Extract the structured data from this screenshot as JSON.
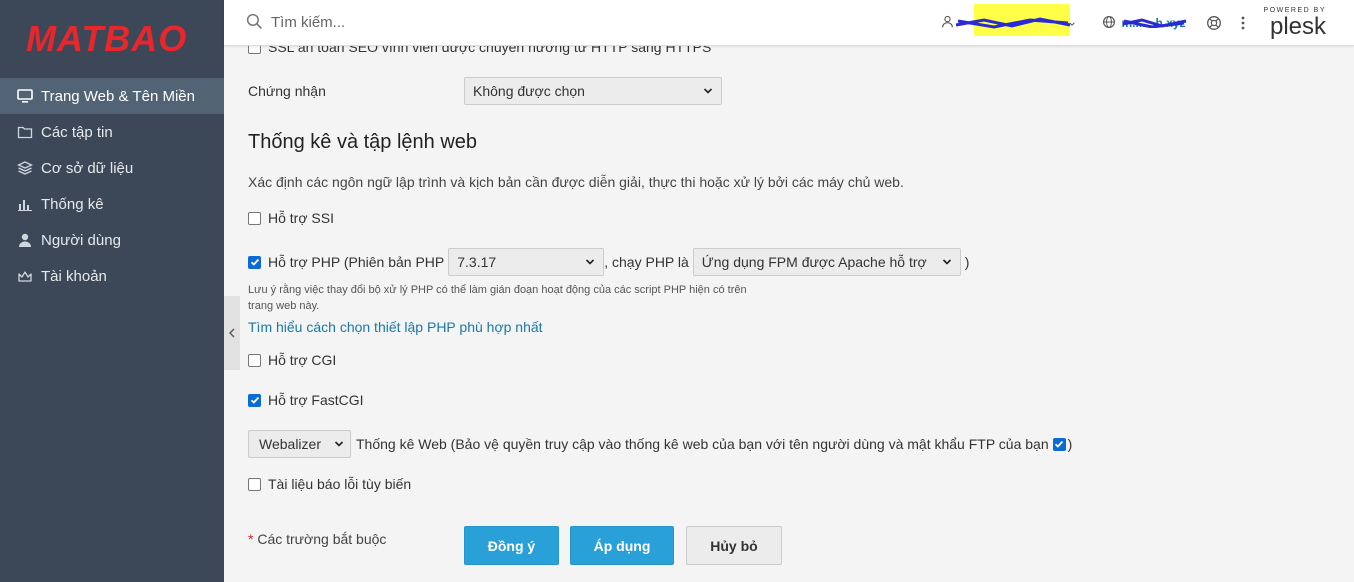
{
  "brand": {
    "logo": "MATBAO"
  },
  "search": {
    "placeholder": "Tìm kiếm..."
  },
  "header": {
    "domain": "m.......h.xyz",
    "powered_by": "POWERED BY",
    "plesk": "plesk"
  },
  "sidebar": {
    "items": [
      {
        "label": "Trang Web & Tên Miền",
        "icon": "monitor-icon",
        "active": true
      },
      {
        "label": "Các tập tin",
        "icon": "folder-icon"
      },
      {
        "label": "Cơ sở dữ liệu",
        "icon": "database-icon"
      },
      {
        "label": "Thống kê",
        "icon": "bar-chart-icon"
      },
      {
        "label": "Người dùng",
        "icon": "user-icon"
      },
      {
        "label": "Tài khoản",
        "icon": "crown-icon"
      }
    ]
  },
  "form": {
    "cut_top_label": "SSL an toàn SEO vĩnh viễn được chuyển hướng từ HTTP sang HTTPS",
    "certificate_label": "Chứng nhận",
    "certificate_value": "Không được chọn",
    "section_title": "Thống kê và tập lệnh web",
    "section_desc": "Xác định các ngôn ngữ lập trình và kịch bản cần được diễn giải, thực thi hoặc xử lý bởi các máy chủ web.",
    "ssi_label": "Hỗ trợ SSI",
    "php_label_pre": "Hỗ trợ PHP (Phiên bản PHP",
    "php_version": "7.3.17",
    "php_run_as_label": ", chạy PHP là",
    "php_handler": "Ứng dụng FPM được Apache hỗ trợ",
    "php_label_post": ")",
    "php_note": "Lưu ý rằng việc thay đổi bộ xử lý PHP có thể làm gián đoạn hoạt động của các script PHP hiện có trên trang web này.",
    "php_link": "Tìm hiểu cách chọn thiết lập PHP phù hợp nhất",
    "cgi_label": "Hỗ trợ CGI",
    "fastcgi_label": "Hỗ trợ FastCGI",
    "stats_tool": "Webalizer",
    "stats_label": "Thống kê Web (Bảo vệ quyền truy cập vào thống kê web của bạn với tên người dùng và mật khẩu FTP của bạn",
    "stats_label_post": ")",
    "custom_error_label": "Tài liệu báo lỗi tùy biến",
    "required_star": "*",
    "required_label": "Các trường bắt buộc",
    "ok_button": "Đồng ý",
    "apply_button": "Áp dụng",
    "cancel_button": "Hủy bỏ"
  },
  "colors": {
    "sidebar_bg": "#3c4858",
    "sidebar_active": "#526375",
    "primary": "#29a0d8",
    "link": "#1a79a8",
    "brand_red": "#e8262b"
  }
}
